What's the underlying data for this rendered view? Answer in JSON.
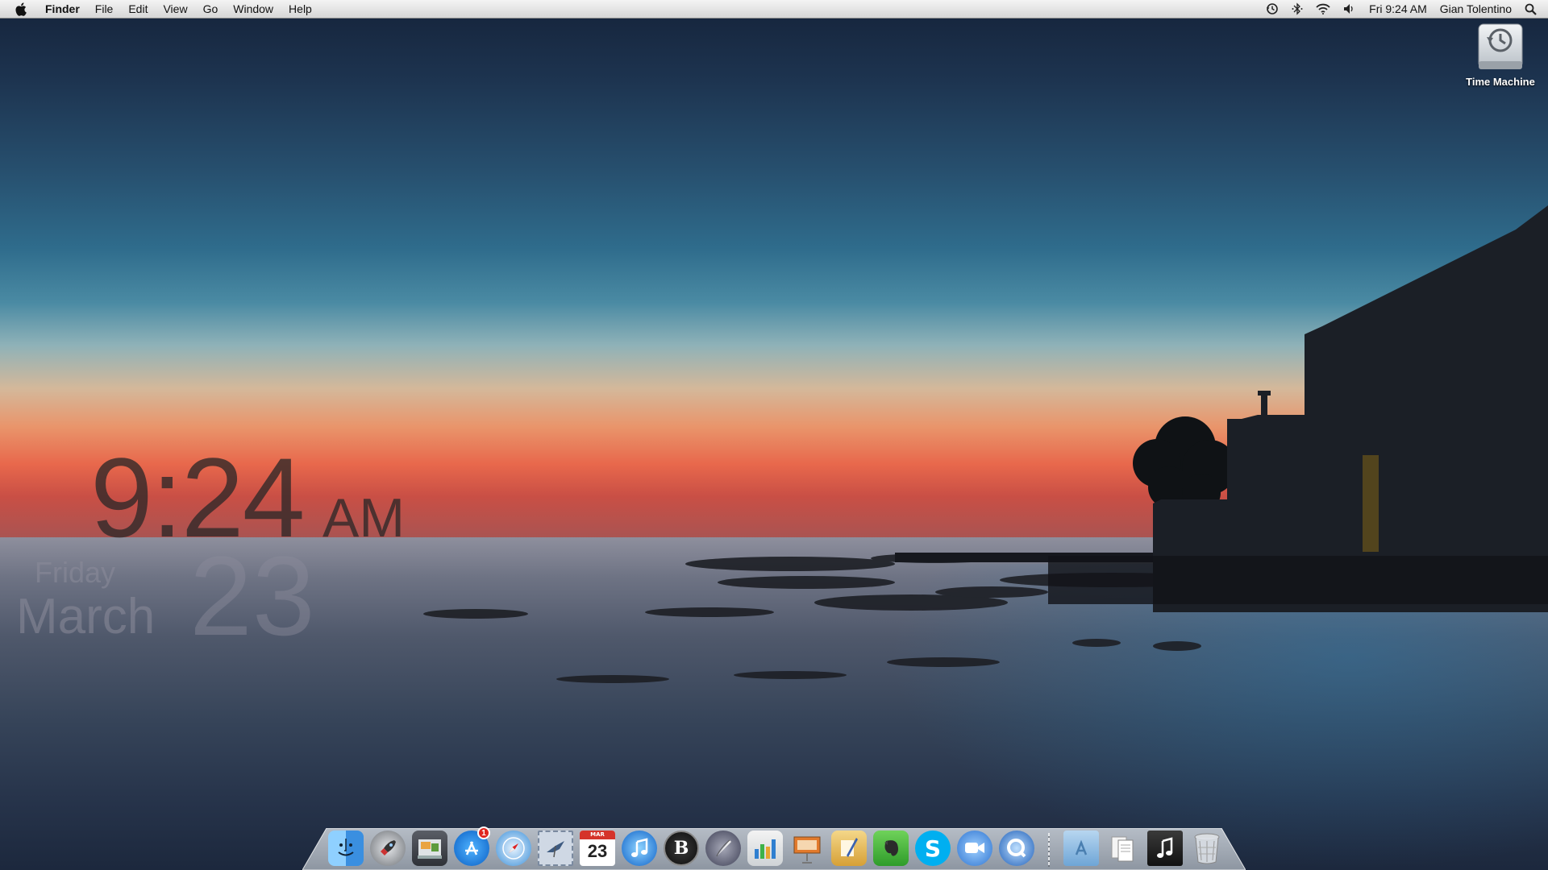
{
  "menubar": {
    "app_name": "Finder",
    "menus": [
      "File",
      "Edit",
      "View",
      "Go",
      "Window",
      "Help"
    ],
    "clock": "Fri 9:24 AM",
    "user": "Gian Tolentino",
    "status_icons": [
      "time-machine-icon",
      "bluetooth-icon",
      "wifi-icon",
      "volume-icon",
      "spotlight-icon"
    ]
  },
  "desktop": {
    "icons": [
      {
        "label": "Time Machine",
        "icon": "hard-drive-icon"
      }
    ]
  },
  "clock_widget": {
    "time": "9:24",
    "ampm": "AM",
    "day": "Friday",
    "month": "March",
    "date": "23"
  },
  "dock": {
    "items": [
      {
        "name": "Finder",
        "icon": "finder-icon",
        "running": true
      },
      {
        "name": "Launchpad",
        "icon": "rocket-icon",
        "running": false
      },
      {
        "name": "Image Capture",
        "icon": "photos-icon",
        "running": false
      },
      {
        "name": "App Store",
        "icon": "app-store-icon",
        "running": true,
        "badge": "1"
      },
      {
        "name": "Safari",
        "icon": "safari-compass-icon",
        "running": true
      },
      {
        "name": "Mail",
        "icon": "mail-stamp-icon",
        "running": true
      },
      {
        "name": "Calendar",
        "icon": "calendar-icon",
        "running": true,
        "date": "23",
        "month": "MAR"
      },
      {
        "name": "iTunes",
        "icon": "music-note-icon",
        "running": true
      },
      {
        "name": "B",
        "icon": "letter-b-icon",
        "running": false
      },
      {
        "name": "Script Editor",
        "icon": "quill-icon",
        "running": false
      },
      {
        "name": "Numbers",
        "icon": "bar-chart-icon",
        "running": false
      },
      {
        "name": "Keynote",
        "icon": "presentation-icon",
        "running": false
      },
      {
        "name": "Pages",
        "icon": "pages-icon",
        "running": false
      },
      {
        "name": "Evernote",
        "icon": "elephant-icon",
        "running": false
      },
      {
        "name": "Skype",
        "icon": "skype-icon",
        "running": false
      },
      {
        "name": "FaceTime",
        "icon": "video-chat-icon",
        "running": false
      },
      {
        "name": "QuickTime",
        "icon": "quicktime-icon",
        "running": true
      }
    ],
    "stacks": [
      {
        "name": "Applications",
        "icon": "apps-folder-icon"
      },
      {
        "name": "Documents",
        "icon": "documents-stack-icon"
      },
      {
        "name": "Music",
        "icon": "music-stack-icon"
      },
      {
        "name": "Trash",
        "icon": "trash-icon"
      }
    ]
  },
  "colors": {
    "menubar": "#e6e6e6",
    "sky_top": "#15233a",
    "horizon": "#e8684c",
    "sea": "#364459"
  }
}
